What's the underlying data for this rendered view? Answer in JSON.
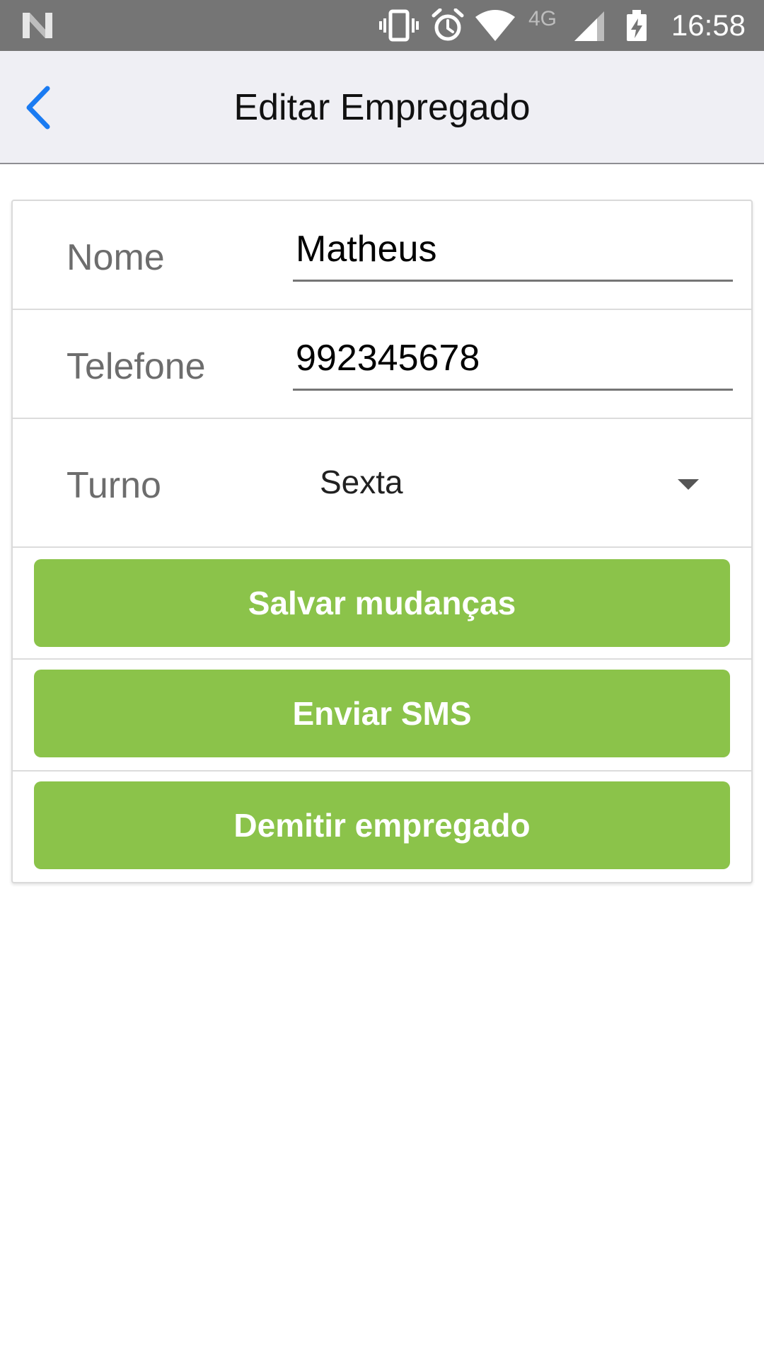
{
  "status_bar": {
    "network_label": "4G",
    "time": "16:58",
    "icons": [
      "n-logo-icon",
      "vibrate-icon",
      "alarm-icon",
      "wifi-icon",
      "cell-signal-icon",
      "battery-charging-icon"
    ]
  },
  "nav": {
    "back_icon": "chevron-left-icon",
    "title": "Editar Empregado"
  },
  "form": {
    "name": {
      "label": "Nome",
      "value": "Matheus"
    },
    "phone": {
      "label": "Telefone",
      "value": "992345678"
    },
    "shift": {
      "label": "Turno",
      "selected": "Sexta"
    }
  },
  "actions": {
    "save_label": "Salvar mudanças",
    "sms_label": "Enviar SMS",
    "dismiss_label": "Demitir empregado"
  },
  "colors": {
    "accent_green": "#8bc34a",
    "ios_blue": "#1a7bf2",
    "status_bar": "#757575",
    "nav_background": "#efeff4"
  }
}
